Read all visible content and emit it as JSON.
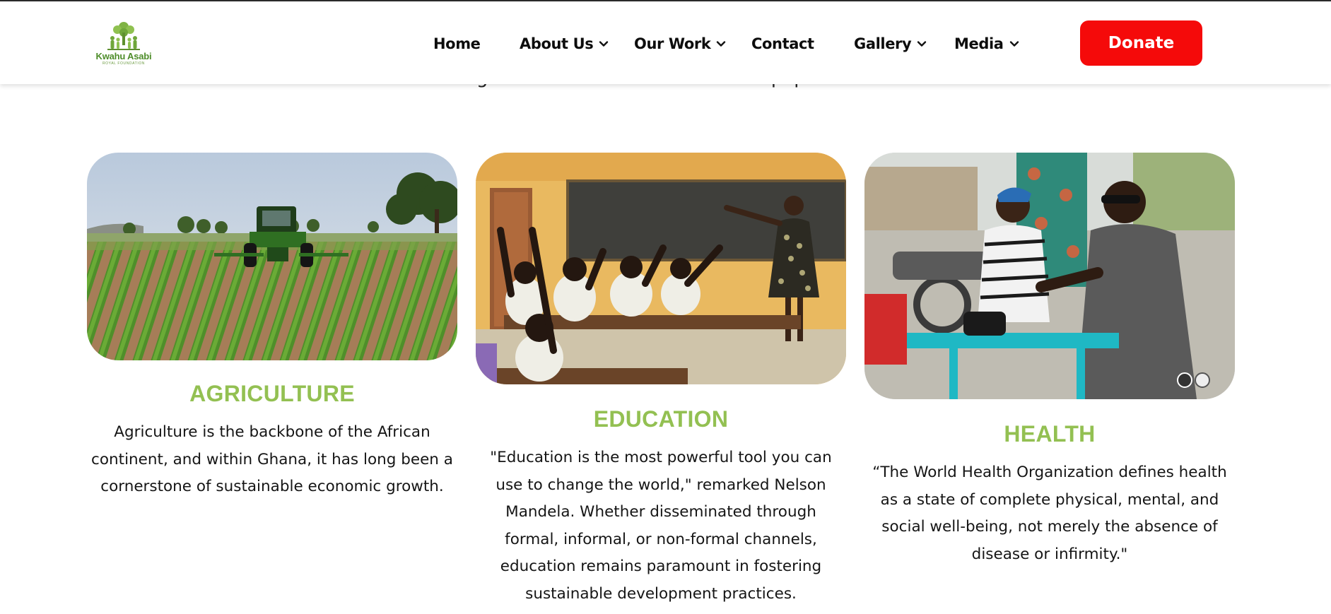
{
  "brand": {
    "logo_text": "Kwahu Asabi",
    "logo_subtext": "ROYAL FOUNDATION",
    "accent_color": "#93c052",
    "donate_color": "#f50a0a"
  },
  "nav": {
    "items": [
      {
        "label": "Home",
        "has_dropdown": false
      },
      {
        "label": "About Us",
        "has_dropdown": true
      },
      {
        "label": "Our Work",
        "has_dropdown": true
      },
      {
        "label": "Contact",
        "has_dropdown": false
      },
      {
        "label": "Gallery",
        "has_dropdown": true
      },
      {
        "label": "Media",
        "has_dropdown": true
      }
    ],
    "donate_label": "Donate"
  },
  "intro": {
    "partial_text": "growth of our communities and populace"
  },
  "cards": [
    {
      "title": "AGRICULTURE",
      "image_icon": "farm-tractor-photo",
      "lines": [
        "Agriculture is the backbone of the African",
        "continent, and within Ghana, it has long been a",
        "cornerstone of sustainable economic growth."
      ]
    },
    {
      "title": "EDUCATION",
      "image_icon": "classroom-photo",
      "lines": [
        "\"Education is the most powerful tool you can",
        "use to change the world,\" remarked Nelson",
        "Mandela. Whether disseminated through",
        "formal, informal, or non-formal channels,",
        "education remains paramount in fostering",
        "sustainable development practices."
      ]
    },
    {
      "title": "HEALTH",
      "image_icon": "health-screening-photo",
      "lines": [
        "“The World Health Organization defines health",
        "as a state of complete physical, mental, and",
        "social well-being, not merely the absence of",
        "disease or infirmity.\""
      ]
    }
  ]
}
